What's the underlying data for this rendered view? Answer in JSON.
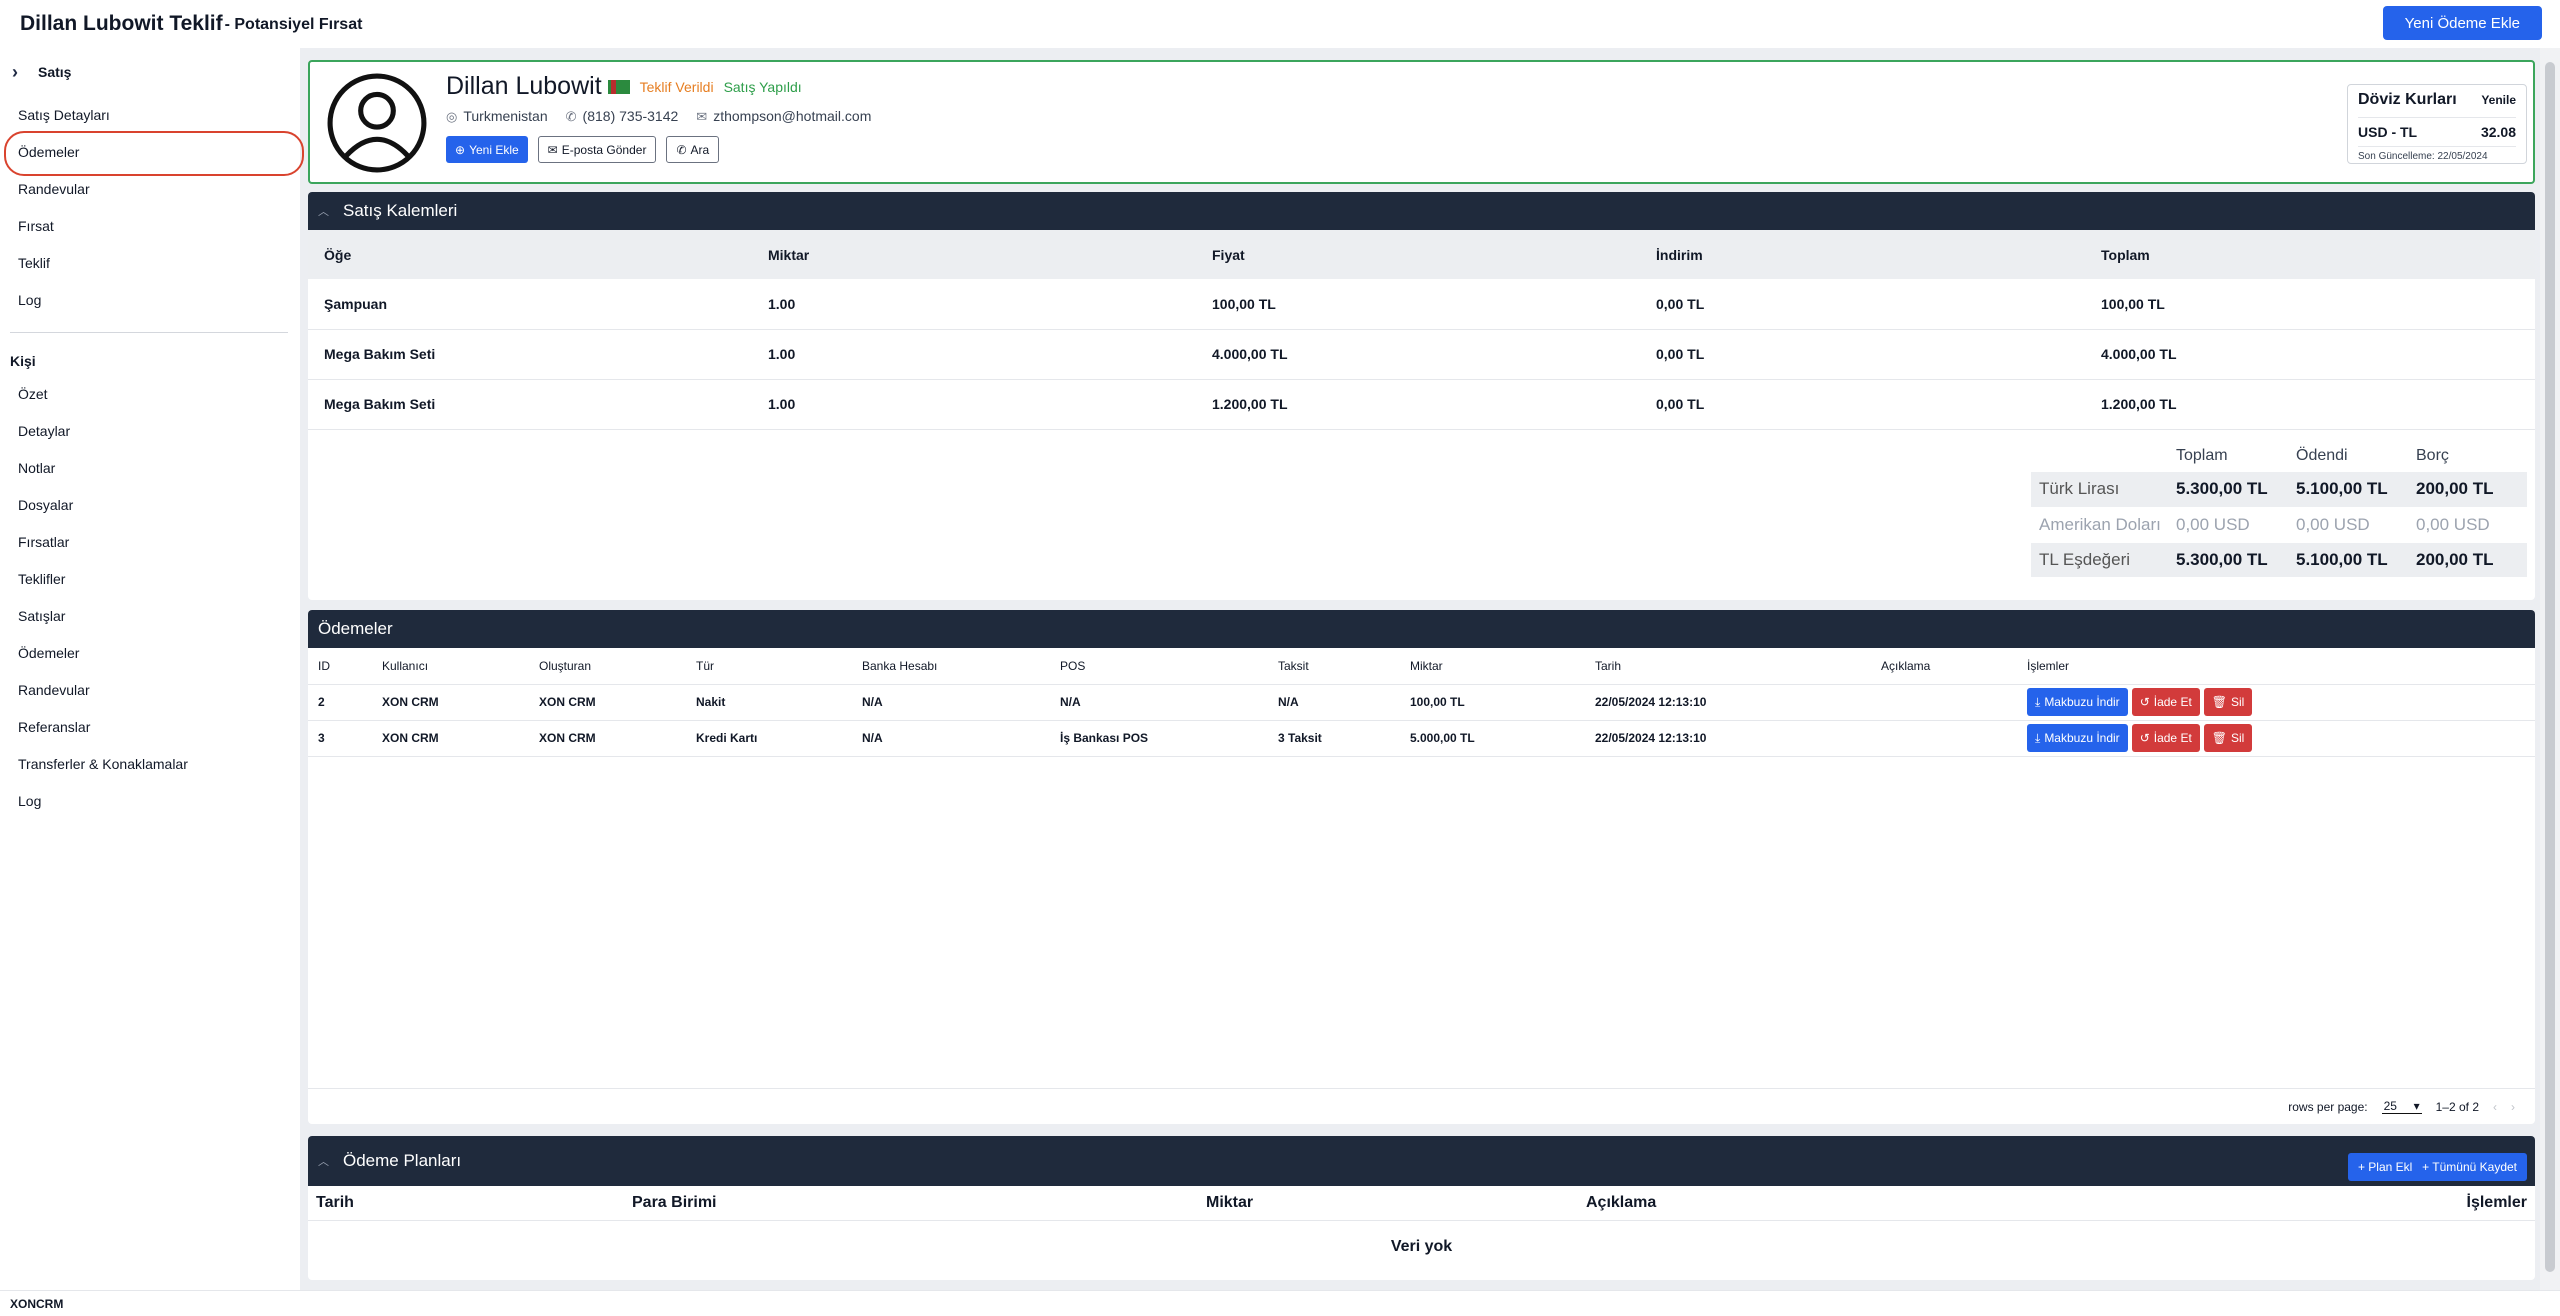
{
  "topbar": {
    "title": "Dillan Lubowit Teklif",
    "subtitle": "- Potansiyel Fırsat",
    "new_payment_label": "Yeni Ödeme Ekle"
  },
  "sidebar": {
    "section1": "Satış",
    "items1": [
      "Satış Detayları",
      "Ödemeler",
      "Randevular",
      "Fırsat",
      "Teklif",
      "Log"
    ],
    "section2": "Kişi",
    "items2": [
      "Özet",
      "Detaylar",
      "Notlar",
      "Dosyalar",
      "Fırsatlar",
      "Teklifler",
      "Satışlar",
      "Ödemeler",
      "Randevular",
      "Referanslar",
      "Transferler & Konaklamalar",
      "Log"
    ]
  },
  "profile": {
    "name": "Dillan Lubowit",
    "status1": "Teklif Verildi",
    "status2": "Satış Yapıldı",
    "country": "Turkmenistan",
    "phone": "(818) 735-3142",
    "email": "zthompson@hotmail.com",
    "btn_new": "Yeni Ekle",
    "btn_email": "E-posta Gönder",
    "btn_call": "Ara"
  },
  "fx": {
    "title": "Döviz Kurları",
    "refresh": "Yenile",
    "pair": "USD - TL",
    "rate": "32.08",
    "updated": "Son Güncelleme: 22/05/2024"
  },
  "items": {
    "title": "Satış Kalemleri",
    "headers": [
      "Öğe",
      "Miktar",
      "Fiyat",
      "İndirim",
      "Toplam"
    ],
    "rows": [
      [
        "Şampuan",
        "1.00",
        "100,00 TL",
        "0,00 TL",
        "100,00 TL"
      ],
      [
        "Mega Bakım Seti",
        "1.00",
        "4.000,00 TL",
        "0,00 TL",
        "4.000,00 TL"
      ],
      [
        "Mega Bakım Seti",
        "1.00",
        "1.200,00 TL",
        "0,00 TL",
        "1.200,00 TL"
      ]
    ]
  },
  "summary": {
    "headers": [
      "",
      "Toplam",
      "Ödendi",
      "Borç"
    ],
    "rows": [
      [
        "Türk Lirası",
        "5.300,00 TL",
        "5.100,00 TL",
        "200,00 TL"
      ],
      [
        "Amerikan Doları",
        "0,00 USD",
        "0,00 USD",
        "0,00 USD"
      ],
      [
        "TL Eşdeğeri",
        "5.300,00 TL",
        "5.100,00 TL",
        "200,00 TL"
      ]
    ]
  },
  "payments": {
    "title": "Ödemeler",
    "headers": [
      "ID",
      "Kullanıcı",
      "Oluşturan",
      "Tür",
      "Banka Hesabı",
      "POS",
      "Taksit",
      "Miktar",
      "Tarih",
      "Açıklama",
      "İşlemler"
    ],
    "rows": [
      [
        "2",
        "XON CRM",
        "XON CRM",
        "Nakit",
        "N/A",
        "N/A",
        "N/A",
        "100,00 TL",
        "22/05/2024 12:13:10",
        ""
      ],
      [
        "3",
        "XON CRM",
        "XON CRM",
        "Kredi Kartı",
        "N/A",
        "İş Bankası POS",
        "3 Taksit",
        "5.000,00 TL",
        "22/05/2024 12:13:10",
        ""
      ]
    ],
    "btn_receipt": "Makbuzu İndir",
    "btn_refund": "İade Et",
    "btn_delete": "Sil",
    "rows_per_page_label": "rows per page:",
    "rows_per_page": "25",
    "range": "1–2 of 2"
  },
  "plans": {
    "title": "Ödeme Planları",
    "btn_add": "+ Plan Ekle",
    "btn_save": "+ Tümünü Kaydet",
    "headers": [
      "Tarih",
      "Para Birimi",
      "Miktar",
      "Açıklama",
      "İşlemler"
    ],
    "empty": "Veri yok"
  },
  "footer": {
    "text": "XONCRM"
  }
}
